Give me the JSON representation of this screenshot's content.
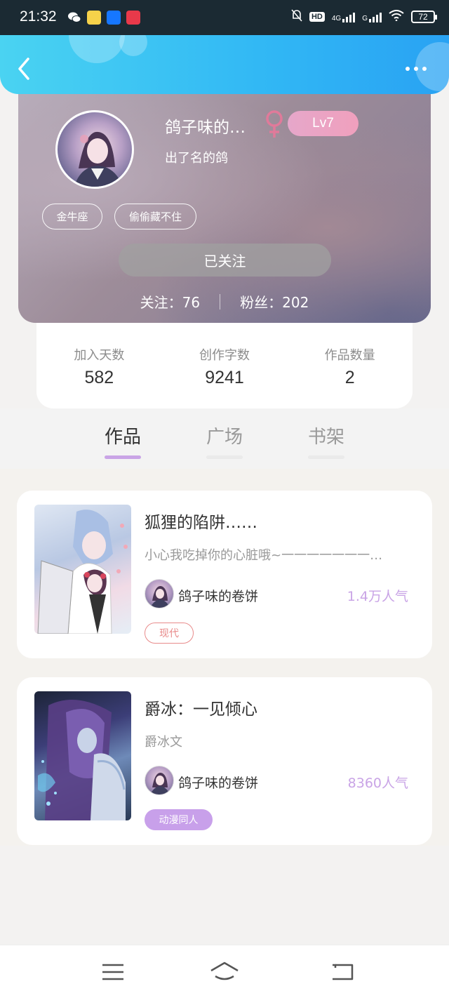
{
  "status_bar": {
    "time": "21:32",
    "hd_label": "HD",
    "network_label": "4G",
    "network_label_2": "G",
    "battery": "72"
  },
  "header": {
    "back_icon": "chevron-left-icon",
    "more_icon": "more-dots-icon"
  },
  "profile": {
    "nickname": "鸽子味的…",
    "gender_icon": "female-icon",
    "level": "Lv7",
    "bio": "出了名的鸽",
    "tags": [
      "金牛座",
      "偷偷藏不住"
    ],
    "follow_button": "已关注",
    "following_label": "关注：76",
    "followers_label": "粉丝：202"
  },
  "stats": [
    {
      "label": "加入天数",
      "value": "582"
    },
    {
      "label": "创作字数",
      "value": "9241"
    },
    {
      "label": "作品数量",
      "value": "2"
    }
  ],
  "tabs": [
    {
      "label": "作品",
      "active": true
    },
    {
      "label": "广场",
      "active": false
    },
    {
      "label": "书架",
      "active": false
    }
  ],
  "works": [
    {
      "title": "狐狸的陷阱……",
      "description": "小心我吃掉你的心脏哦~一一一一一一一…",
      "author": "鸽子味的卷饼",
      "popularity": "1.4万人气",
      "genre": "现代"
    },
    {
      "title": "爵冰：一见倾心",
      "description": "爵冰文",
      "author": "鸽子味的卷饼",
      "popularity": "8360人气",
      "genre": "动漫同人"
    }
  ],
  "colors": {
    "header_gradient_start": "#4ad3f2",
    "header_gradient_end": "#29a2f3",
    "accent_purple": "#c9a4e6",
    "gender_pink": "#e07a9a",
    "tag_modern": "#e88a8a",
    "tag_anime": "#c8a0ea"
  }
}
